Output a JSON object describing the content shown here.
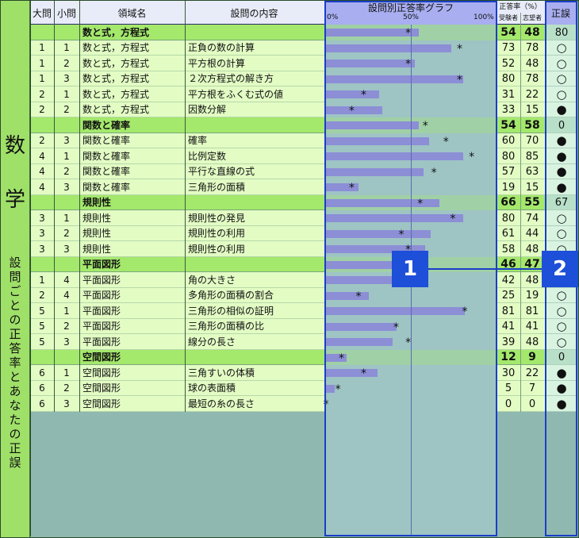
{
  "subject_heading": "数学",
  "side_caption": "設問ごとの正答率とあなたの正誤",
  "headers": {
    "major": "大問",
    "minor": "小問",
    "domain": "領域名",
    "content": "設問の内容",
    "graph_title": "設問別正答率グラフ",
    "rate_title": "正答率（%）",
    "examinees": "受験者",
    "applicants": "志望者",
    "judgement": "正誤"
  },
  "graph_scale": [
    "0%",
    "50%",
    "100%"
  ],
  "legend": {
    "correct": "○",
    "incorrect": "●"
  },
  "callouts": [
    "1",
    "2"
  ],
  "colors": {
    "accent_blue": "#1a3ec8",
    "callout_fill": "#1d4fd8",
    "bar": "#8c8ed6",
    "cat_row": "#a4e86c",
    "item_row": "#e2fcc4",
    "graph_bg": "#9ec4c4",
    "side_panel": "#9fe069"
  },
  "rows": [
    {
      "type": "category",
      "domain": "数と式，方程式",
      "rate": 54,
      "applicant": 48,
      "mark": "80"
    },
    {
      "type": "item",
      "major": "1",
      "minor": "1",
      "domain": "数と式，方程式",
      "content": "正負の数の計算",
      "rate": 73,
      "applicant": 78,
      "mark": "○"
    },
    {
      "type": "item",
      "major": "1",
      "minor": "2",
      "domain": "数と式，方程式",
      "content": "平方根の計算",
      "rate": 52,
      "applicant": 48,
      "mark": "○"
    },
    {
      "type": "item",
      "major": "1",
      "minor": "3",
      "domain": "数と式，方程式",
      "content": "２次方程式の解き方",
      "rate": 80,
      "applicant": 78,
      "mark": "○"
    },
    {
      "type": "item",
      "major": "2",
      "minor": "1",
      "domain": "数と式，方程式",
      "content": "平方根をふくむ式の値",
      "rate": 31,
      "applicant": 22,
      "mark": "○"
    },
    {
      "type": "item",
      "major": "2",
      "minor": "2",
      "domain": "数と式，方程式",
      "content": "因数分解",
      "rate": 33,
      "applicant": 15,
      "mark": "●"
    },
    {
      "type": "category",
      "domain": "関数と確率",
      "rate": 54,
      "applicant": 58,
      "mark": "0"
    },
    {
      "type": "item",
      "major": "2",
      "minor": "3",
      "domain": "関数と確率",
      "content": "確率",
      "rate": 60,
      "applicant": 70,
      "mark": "●"
    },
    {
      "type": "item",
      "major": "4",
      "minor": "1",
      "domain": "関数と確率",
      "content": "比例定数",
      "rate": 80,
      "applicant": 85,
      "mark": "●"
    },
    {
      "type": "item",
      "major": "4",
      "minor": "2",
      "domain": "関数と確率",
      "content": "平行な直線の式",
      "rate": 57,
      "applicant": 63,
      "mark": "●"
    },
    {
      "type": "item",
      "major": "4",
      "minor": "3",
      "domain": "関数と確率",
      "content": "三角形の面積",
      "rate": 19,
      "applicant": 15,
      "mark": "●"
    },
    {
      "type": "category",
      "domain": "規則性",
      "rate": 66,
      "applicant": 55,
      "mark": "67"
    },
    {
      "type": "item",
      "major": "3",
      "minor": "1",
      "domain": "規則性",
      "content": "規則性の発見",
      "rate": 80,
      "applicant": 74,
      "mark": "○"
    },
    {
      "type": "item",
      "major": "3",
      "minor": "2",
      "domain": "規則性",
      "content": "規則性の利用",
      "rate": 61,
      "applicant": 44,
      "mark": "○"
    },
    {
      "type": "item",
      "major": "3",
      "minor": "3",
      "domain": "規則性",
      "content": "規則性の利用",
      "rate": 58,
      "applicant": 48,
      "mark": "○"
    },
    {
      "type": "category",
      "domain": "平面図形",
      "rate": 46,
      "applicant": 47,
      "mark": "20"
    },
    {
      "type": "item",
      "major": "1",
      "minor": "4",
      "domain": "平面図形",
      "content": "角の大きさ",
      "rate": 42,
      "applicant": 48,
      "mark": "○"
    },
    {
      "type": "item",
      "major": "2",
      "minor": "4",
      "domain": "平面図形",
      "content": "多角形の面積の割合",
      "rate": 25,
      "applicant": 19,
      "mark": "○"
    },
    {
      "type": "item",
      "major": "5",
      "minor": "1",
      "domain": "平面図形",
      "content": "三角形の相似の証明",
      "rate": 81,
      "applicant": 81,
      "mark": "○"
    },
    {
      "type": "item",
      "major": "5",
      "minor": "2",
      "domain": "平面図形",
      "content": "三角形の面積の比",
      "rate": 41,
      "applicant": 41,
      "mark": "○"
    },
    {
      "type": "item",
      "major": "5",
      "minor": "3",
      "domain": "平面図形",
      "content": "線分の長さ",
      "rate": 39,
      "applicant": 48,
      "mark": "○"
    },
    {
      "type": "category",
      "domain": "空間図形",
      "rate": 12,
      "applicant": 9,
      "mark": "0"
    },
    {
      "type": "item",
      "major": "6",
      "minor": "1",
      "domain": "空間図形",
      "content": "三角すいの体積",
      "rate": 30,
      "applicant": 22,
      "mark": "●"
    },
    {
      "type": "item",
      "major": "6",
      "minor": "2",
      "domain": "空間図形",
      "content": "球の表面積",
      "rate": 5,
      "applicant": 7,
      "mark": "●"
    },
    {
      "type": "item",
      "major": "6",
      "minor": "3",
      "domain": "空間図形",
      "content": "最短の糸の長さ",
      "rate": 0,
      "applicant": 0,
      "mark": "●"
    }
  ]
}
